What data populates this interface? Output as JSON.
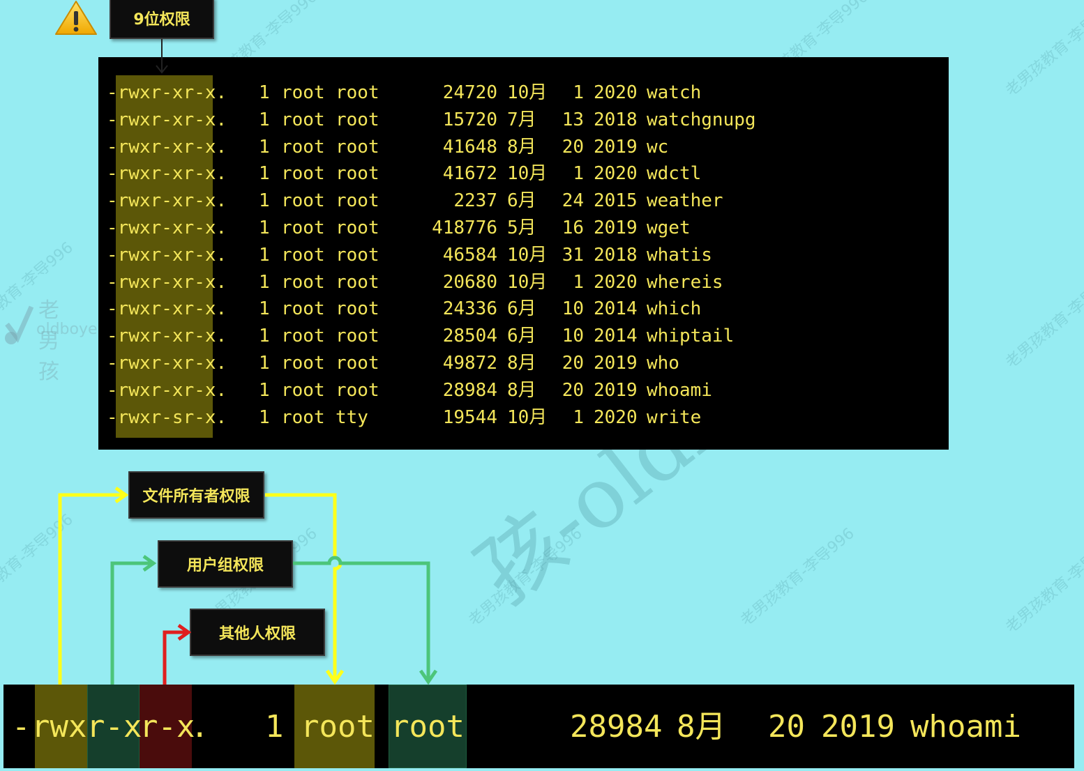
{
  "labels": {
    "nine_bit": "9位权限",
    "owner_perm": "文件所有者权限",
    "group_perm": "用户组权限",
    "other_perm": "其他人权限"
  },
  "watermarks": {
    "text": "老男孩教育-李导996",
    "logo_cn": "老男孩",
    "logo_en": "oldboye",
    "big": "孩-oldboy"
  },
  "colors": {
    "background": "#96ecf2",
    "terminal_text": "#f4e65a",
    "owner_arrow": "#ffff1a",
    "group_arrow": "#4cc57a",
    "other_arrow": "#e01f1f"
  },
  "terminal_rows": [
    {
      "perm": "-rwxr-xr-x.",
      "links": "1",
      "owner": "root",
      "group": "root",
      "size": "24720",
      "month": "10月",
      "day": "1",
      "year": "2020",
      "name": "watch"
    },
    {
      "perm": "-rwxr-xr-x.",
      "links": "1",
      "owner": "root",
      "group": "root",
      "size": "15720",
      "month": "7月",
      "day": "13",
      "year": "2018",
      "name": "watchgnupg"
    },
    {
      "perm": "-rwxr-xr-x.",
      "links": "1",
      "owner": "root",
      "group": "root",
      "size": "41648",
      "month": "8月",
      "day": "20",
      "year": "2019",
      "name": "wc"
    },
    {
      "perm": "-rwxr-xr-x.",
      "links": "1",
      "owner": "root",
      "group": "root",
      "size": "41672",
      "month": "10月",
      "day": "1",
      "year": "2020",
      "name": "wdctl"
    },
    {
      "perm": "-rwxr-xr-x.",
      "links": "1",
      "owner": "root",
      "group": "root",
      "size": "2237",
      "month": "6月",
      "day": "24",
      "year": "2015",
      "name": "weather"
    },
    {
      "perm": "-rwxr-xr-x.",
      "links": "1",
      "owner": "root",
      "group": "root",
      "size": "418776",
      "month": "5月",
      "day": "16",
      "year": "2019",
      "name": "wget"
    },
    {
      "perm": "-rwxr-xr-x.",
      "links": "1",
      "owner": "root",
      "group": "root",
      "size": "46584",
      "month": "10月",
      "day": "31",
      "year": "2018",
      "name": "whatis"
    },
    {
      "perm": "-rwxr-xr-x.",
      "links": "1",
      "owner": "root",
      "group": "root",
      "size": "20680",
      "month": "10月",
      "day": "1",
      "year": "2020",
      "name": "whereis"
    },
    {
      "perm": "-rwxr-xr-x.",
      "links": "1",
      "owner": "root",
      "group": "root",
      "size": "24336",
      "month": "6月",
      "day": "10",
      "year": "2014",
      "name": "which"
    },
    {
      "perm": "-rwxr-xr-x.",
      "links": "1",
      "owner": "root",
      "group": "root",
      "size": "28504",
      "month": "6月",
      "day": "10",
      "year": "2014",
      "name": "whiptail"
    },
    {
      "perm": "-rwxr-xr-x.",
      "links": "1",
      "owner": "root",
      "group": "root",
      "size": "49872",
      "month": "8月",
      "day": "20",
      "year": "2019",
      "name": "who"
    },
    {
      "perm": "-rwxr-xr-x.",
      "links": "1",
      "owner": "root",
      "group": "root",
      "size": "28984",
      "month": "8月",
      "day": "20",
      "year": "2019",
      "name": "whoami"
    },
    {
      "perm": "-rwxr-sr-x.",
      "links": "1",
      "owner": "root",
      "group": "tty",
      "size": "19544",
      "month": "10月",
      "day": "1",
      "year": "2020",
      "name": "write"
    }
  ],
  "detail": {
    "type_char": "-",
    "owner_bits": "rwx",
    "group_bits": "r-x",
    "other_bits": "r-x",
    "suffix": ".",
    "links": "1",
    "owner": "root",
    "group": "root",
    "size": "28984",
    "month": "8月",
    "day": "20",
    "year": "2019",
    "name": "whoami"
  }
}
